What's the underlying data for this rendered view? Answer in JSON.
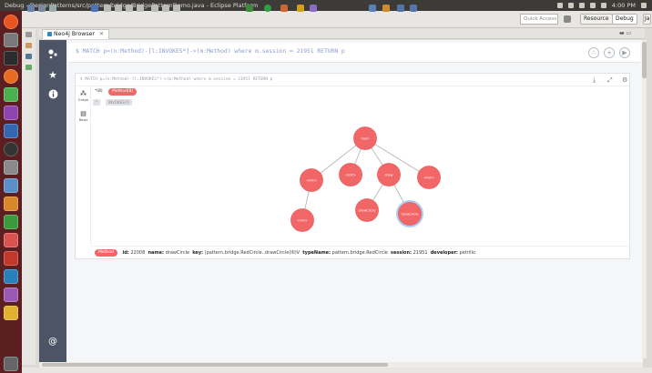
{
  "window": {
    "title": "Debug - DesignPatterns/src/pattern/bridge/BridgePatternDemo.java - Eclipse Platform",
    "clock": "4:00 PM"
  },
  "toolbar": {
    "quick_access_placeholder": "Quick Access",
    "perspective_resource": "Resource",
    "perspective_debug": "Debug",
    "perspective_java": "Ja"
  },
  "tab": {
    "label": "Neo4j Browser",
    "close": "✕"
  },
  "editor": {
    "prompt": "$",
    "query": "MATCH p=(n:Method)-[l:INVOKES*]->(m:Method) where m.session = 21951 RETURN p"
  },
  "result": {
    "query": "$ MATCH p=(n:Method)-[l:INVOKES*]->(m:Method) where m.session = 21951 RETURN p",
    "all_count": "*(8)",
    "label_pill": "Method(8)",
    "sub_chip_1": "*",
    "sub_chip_2": "INVOKES(7)"
  },
  "viewbar": {
    "graph": "Graph",
    "rows": "Rows"
  },
  "graph": {
    "nodes": [
      {
        "id": "n1",
        "label": "main",
        "highlight": false
      },
      {
        "id": "n2",
        "label": "<init>",
        "highlight": false
      },
      {
        "id": "n3",
        "label": "<init>",
        "highlight": false
      },
      {
        "id": "n4",
        "label": "draw",
        "highlight": false
      },
      {
        "id": "n5",
        "label": "<init>",
        "highlight": false
      },
      {
        "id": "n6",
        "label": "<init>",
        "highlight": false
      },
      {
        "id": "n7",
        "label": "drawCircle",
        "highlight": false
      },
      {
        "id": "n8",
        "label": "drawCircle",
        "highlight": true
      }
    ],
    "node_color": "#f16667",
    "highlight_ring": "#aecbf0"
  },
  "detail": {
    "pill": "Method",
    "id_key": "id:",
    "id_val": "22008",
    "name_key": "name:",
    "name_val": "drawCircle",
    "key_key": "key:",
    "key_val": "(pattern.bridge.RedCircle..drawCircle(III)V",
    "typename_key": "typeName:",
    "typename_val": "pattern.bridge.RedCircle",
    "session_key": "session:",
    "session_val": "21951",
    "developer_key": "developer:",
    "developer_val": "petrillo"
  }
}
